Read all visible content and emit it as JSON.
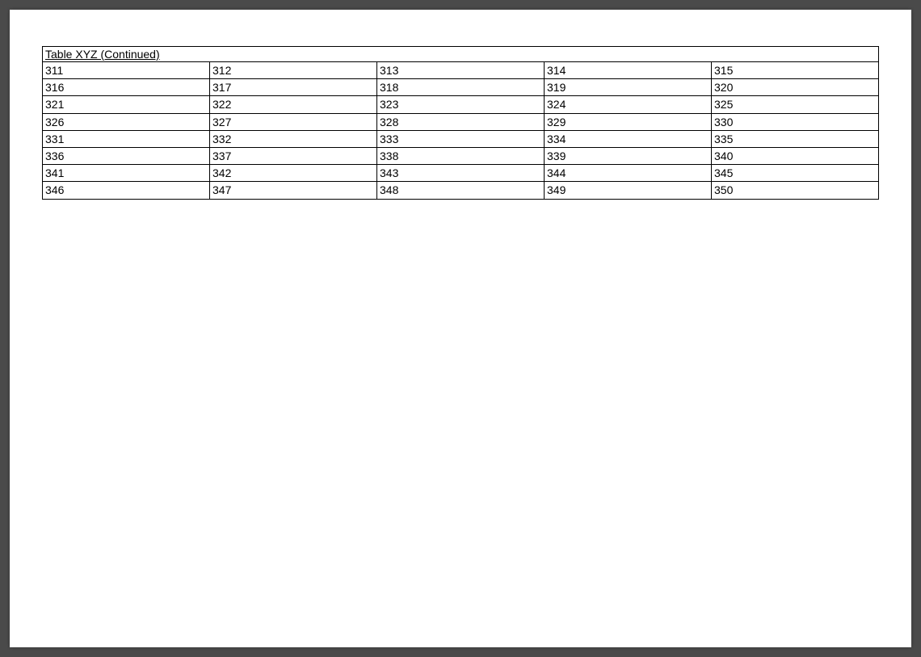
{
  "table": {
    "title": "Table XYZ (Continued)",
    "rows": [
      [
        "311",
        "312",
        "313",
        "314",
        "315"
      ],
      [
        "316",
        "317",
        "318",
        "319",
        "320"
      ],
      [
        "321",
        "322",
        "323",
        "324",
        "325"
      ],
      [
        "326",
        "327",
        "328",
        "329",
        "330"
      ],
      [
        "331",
        "332",
        "333",
        "334",
        "335"
      ],
      [
        "336",
        "337",
        "338",
        "339",
        "340"
      ],
      [
        "341",
        "342",
        "343",
        "344",
        "345"
      ],
      [
        "346",
        "347",
        "348",
        "349",
        "350"
      ]
    ]
  }
}
